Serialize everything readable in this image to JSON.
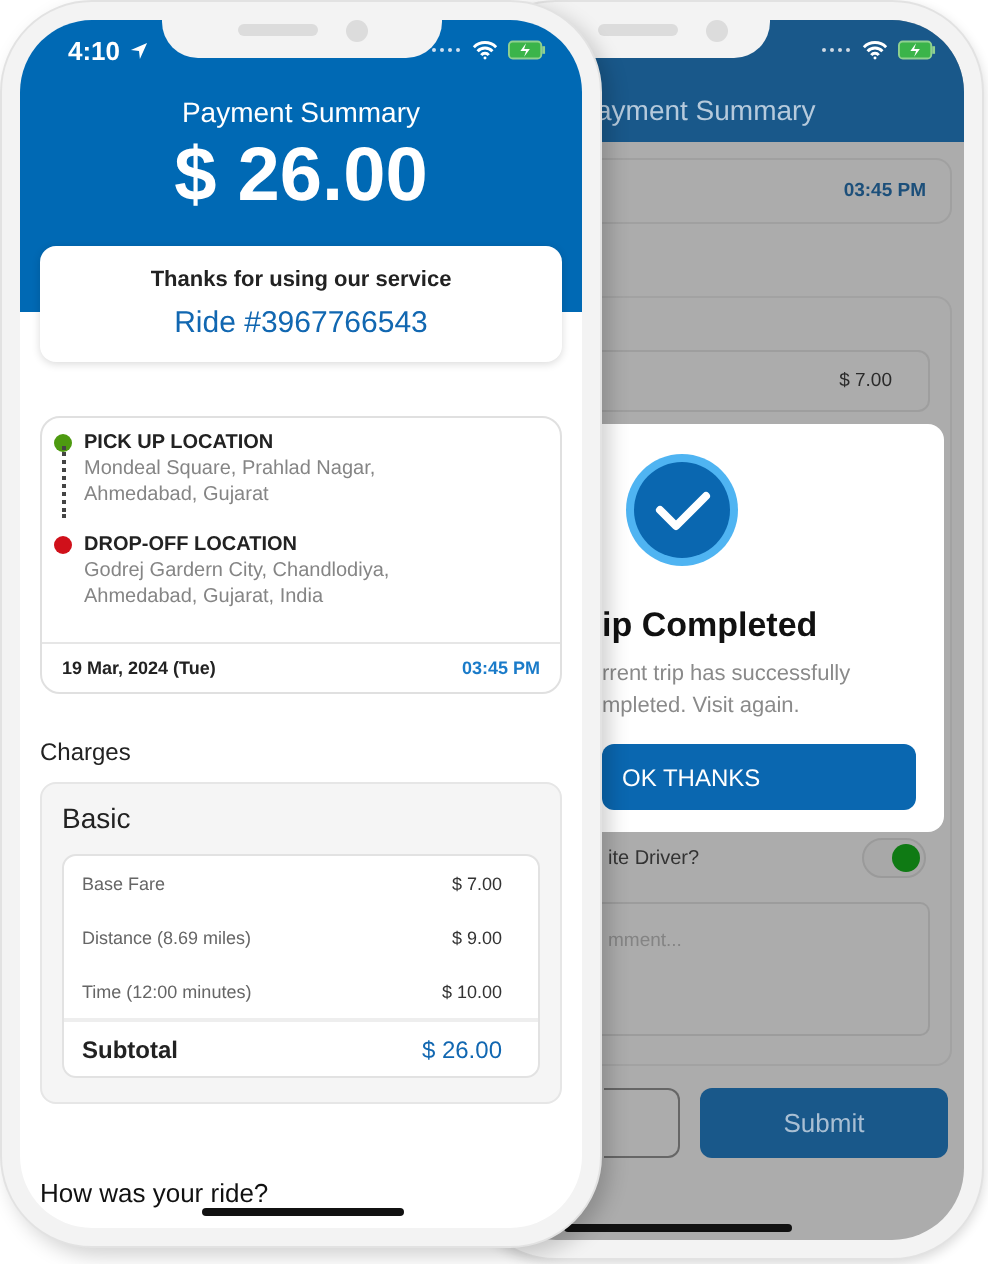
{
  "front_phone": {
    "status_bar": {
      "time": "4:10"
    },
    "header": {
      "title": "Payment Summary",
      "amount": "$ 26.00"
    },
    "thanks_card": {
      "message": "Thanks for using our service",
      "ride": "Ride #3967766543"
    },
    "trip": {
      "stops": [
        {
          "kind": "pickup",
          "label": "PICK UP LOCATION",
          "address": "Mondeal Square, Prahlad Nagar, Ahmedabad, Gujarat",
          "color": "#4d9a10"
        },
        {
          "kind": "dropoff",
          "label": "DROP-OFF LOCATION",
          "address": "Godrej Gardern City, Chandlodiya, Ahmedabad, Gujarat, India",
          "color": "#d0101a"
        }
      ],
      "date": "19 Mar, 2024 (Tue)",
      "time": "03:45 PM"
    },
    "charges": {
      "title": "Charges",
      "plan": "Basic",
      "items": [
        {
          "label": "Base Fare",
          "amount": "$ 7.00"
        },
        {
          "label": "Distance (8.69 miles)",
          "amount": "$ 9.00"
        },
        {
          "label": "Time (12:00 minutes)",
          "amount": "$ 10.00"
        }
      ],
      "subtotal": {
        "label": "Subtotal",
        "amount": "$ 26.00"
      }
    },
    "rating_prompt": "How was your ride?"
  },
  "back_phone": {
    "header_title": "ayment Summary",
    "trip_time": "03:45 PM",
    "fare": "$ 7.00",
    "favorite": {
      "label": "ite Driver?",
      "on": true
    },
    "comment": {
      "placeholder": "mment..."
    },
    "submit": "Submit",
    "dialog": {
      "title": "ip Completed",
      "message": "rrent trip has successfully\nmpleted. Visit again.",
      "button": "OK THANKS"
    }
  }
}
